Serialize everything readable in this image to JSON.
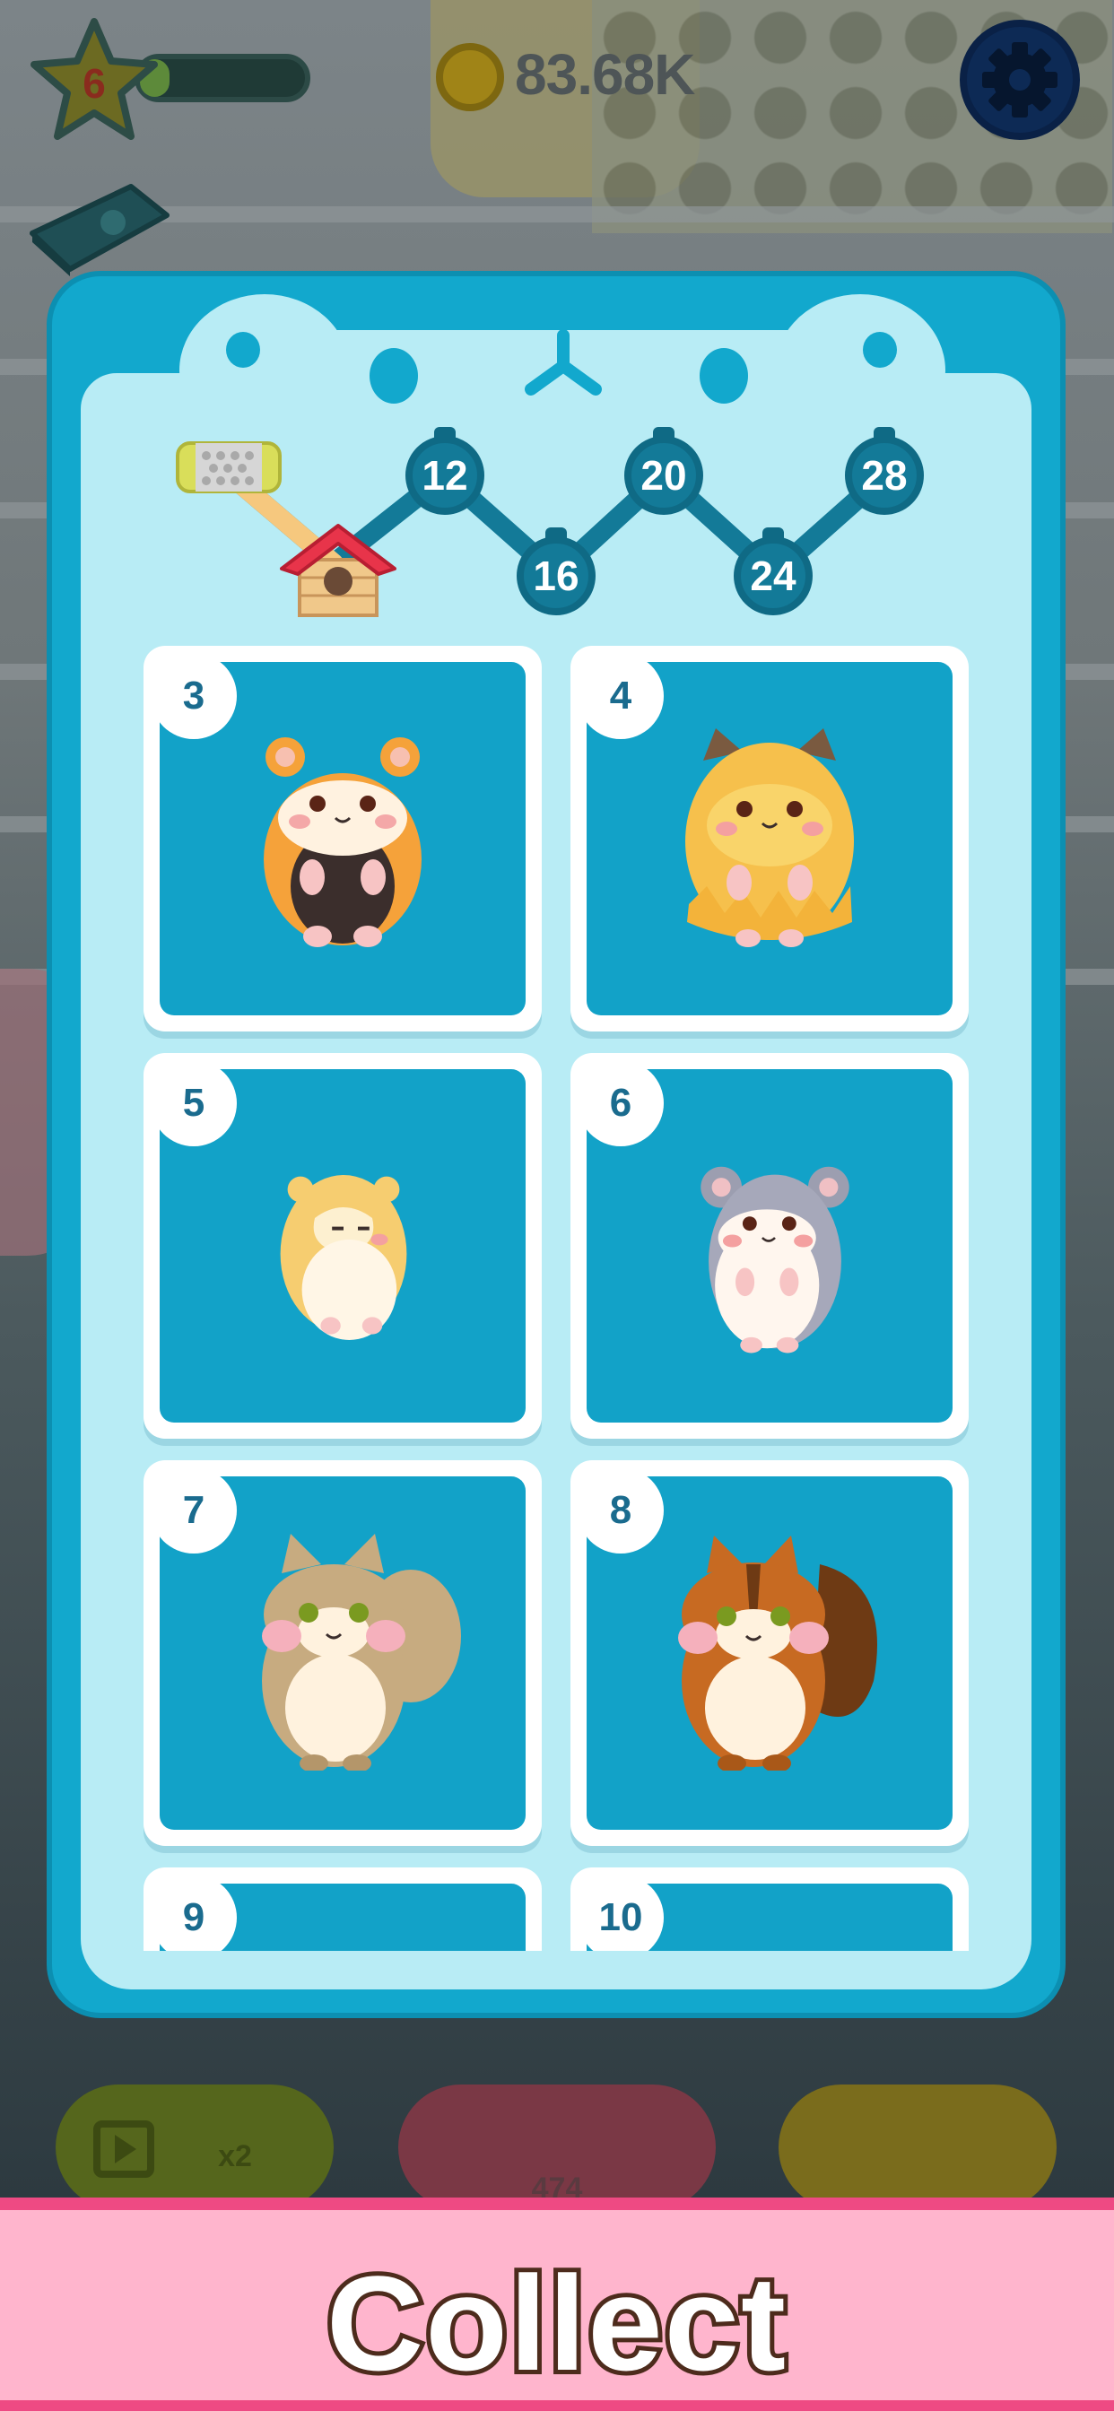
{
  "hud": {
    "level": "6",
    "coins": "83.68K",
    "settings_icon": "gear-icon",
    "book_icon": "collection-book-icon"
  },
  "scene_buttons": {
    "ad_boost_label": "x2",
    "buy_hamster_price": "474"
  },
  "track": {
    "milestones": [
      "12",
      "16",
      "20",
      "24",
      "28"
    ],
    "icons": [
      "wheel-roller-icon",
      "hamster-house-icon"
    ]
  },
  "cards": [
    {
      "level": "3",
      "animal": "orange-hamster"
    },
    {
      "level": "4",
      "animal": "golden-fluffy-hamster"
    },
    {
      "level": "5",
      "animal": "cream-hamster"
    },
    {
      "level": "6",
      "animal": "grey-hamster"
    },
    {
      "level": "7",
      "animal": "tan-squirrel"
    },
    {
      "level": "8",
      "animal": "brown-chipmunk"
    },
    {
      "level": "9",
      "animal": ""
    },
    {
      "level": "10",
      "animal": ""
    }
  ],
  "banner": {
    "title": "Collect"
  },
  "colors": {
    "panel": "#12a8cd",
    "panel_inner": "#b8ecf5",
    "banner_bg": "#ffb5cd",
    "banner_border": "#ee4a83",
    "badge_text": "#1a6b8e"
  }
}
